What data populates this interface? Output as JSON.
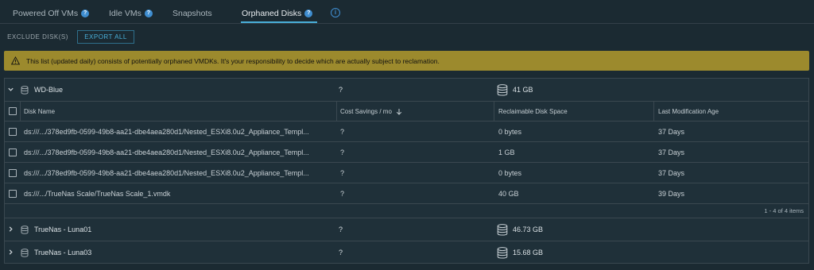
{
  "tabs": [
    {
      "label": "Powered Off VMs"
    },
    {
      "label": "Idle VMs"
    },
    {
      "label": "Snapshots"
    },
    {
      "label": "Orphaned Disks"
    }
  ],
  "help_glyph": "?",
  "info_glyph": "i",
  "toolbar": {
    "exclude_label": "EXCLUDE DISK(S)",
    "export_label": "EXPORT ALL"
  },
  "alert": {
    "text": "This list (updated daily) consists of potentially orphaned VMDKs. It's your responsibility to decide which are actually subject to reclamation."
  },
  "groups": [
    {
      "name": "WD-Blue",
      "cost": "?",
      "space": "41 GB",
      "expanded": true
    },
    {
      "name": "TrueNas - Luna01",
      "cost": "?",
      "space": "46.73 GB",
      "expanded": false
    },
    {
      "name": "TrueNas - Luna03",
      "cost": "?",
      "space": "15.68 GB",
      "expanded": false
    }
  ],
  "columns": {
    "disk_name": "Disk Name",
    "cost_savings": "Cost Savings / mo",
    "reclaimable": "Reclaimable Disk Space",
    "last_mod": "Last Modification Age"
  },
  "disks": [
    {
      "name": "ds:///.../378ed9fb-0599-49b8-aa21-dbe4aea280d1/Nested_ESXi8.0u2_Appliance_Templ...",
      "cost": "?",
      "space": "0 bytes",
      "age": "37 Days"
    },
    {
      "name": "ds:///.../378ed9fb-0599-49b8-aa21-dbe4aea280d1/Nested_ESXi8.0u2_Appliance_Templ...",
      "cost": "?",
      "space": "1 GB",
      "age": "37 Days"
    },
    {
      "name": "ds:///.../378ed9fb-0599-49b8-aa21-dbe4aea280d1/Nested_ESXi8.0u2_Appliance_Templ...",
      "cost": "?",
      "space": "0 bytes",
      "age": "37 Days"
    },
    {
      "name": "ds:///.../TrueNas Scale/TrueNas Scale_1.vmdk",
      "cost": "?",
      "space": "40 GB",
      "age": "39 Days"
    }
  ],
  "pagination": {
    "text": "1 - 4 of 4 items"
  },
  "colors": {
    "accent": "#49afd9",
    "alert_bg": "#9c8a2d",
    "background": "#1b2a32"
  }
}
